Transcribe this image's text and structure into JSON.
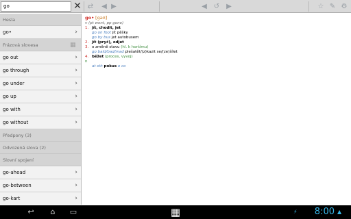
{
  "search": {
    "value": "go"
  },
  "toolbar": {
    "icons": [
      "back-icon",
      "forward-icon",
      "history-icon",
      "next-icon",
      "star-icon",
      "settings-icon",
      "gear-icon"
    ]
  },
  "left": {
    "sections": [
      {
        "title": "Hesla",
        "rows": [
          "go•"
        ]
      },
      {
        "title": "Frázová slovesa",
        "rows": [
          "go out",
          "go through",
          "go under",
          "go up",
          "go with",
          "go without"
        ]
      },
      {
        "title": "Předpony (3)",
        "rows": []
      },
      {
        "title": "Odvozená slova (2)",
        "rows": []
      },
      {
        "title": "Slovní spojení",
        "rows": [
          "go-ahead",
          "go-between",
          "go-kart"
        ]
      }
    ]
  },
  "entry": {
    "headword": "go•",
    "pron": "[gəʊ]",
    "forms": "v (pt went, pp gone)",
    "senses": [
      {
        "n": "1.",
        "def": "jít, chodit, jet",
        "examples": [
          [
            "go on foot",
            " jít pěšky"
          ],
          [
            "go by bus",
            " jet autobusem"
          ]
        ]
      },
      {
        "n": "2.",
        "def": "jít (pryč), odjet",
        "examples": []
      },
      {
        "n": "3.",
        "def_pre": "o změně stavu ",
        "label": "(hl. k horšímu)",
        "examples": [
          [
            "go bald/bad/mad",
            " plešatět/(z)kazit se/(ze)šílet"
          ]
        ]
      },
      {
        "n": "4.",
        "def": "běžet",
        "label": " (proces, vyvoj)",
        "examples": []
      }
    ],
    "pos2": "n",
    "phrase": {
      "pre": "at sth ",
      "bold": "pokus",
      "post": " o co"
    }
  },
  "statusbar": {
    "time": "8:00",
    "icons": [
      "back-nav-icon",
      "home-nav-icon",
      "recent-nav-icon",
      "screenshot-icon",
      "apps-icon"
    ]
  }
}
